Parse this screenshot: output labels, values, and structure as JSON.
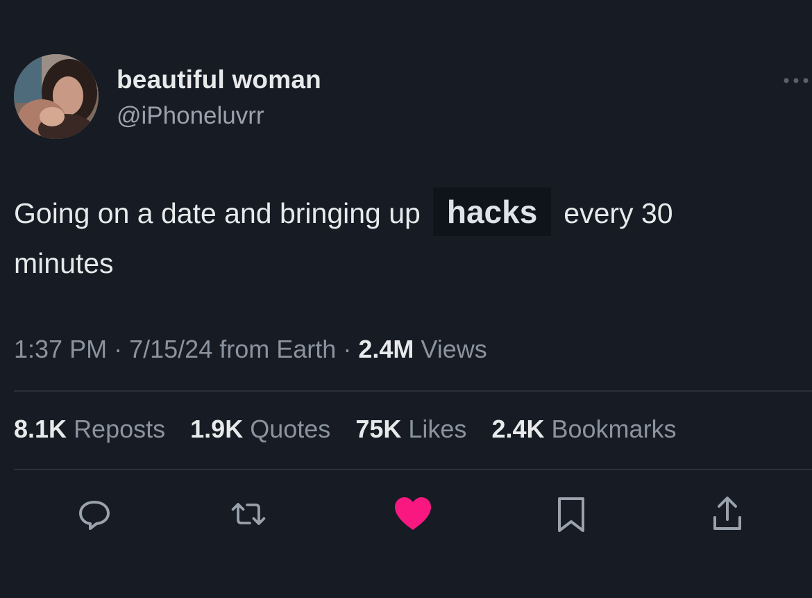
{
  "tweet": {
    "author_name": "beautiful woman",
    "author_handle": "@iPhoneluvrr",
    "text_before": "Going on a date and bringing up",
    "text_highlight": "hacks",
    "text_after": "every 30",
    "text_line2": "minutes"
  },
  "meta": {
    "time": "1:37 PM",
    "separator1": "·",
    "date": "7/15/24",
    "source": "from Earth",
    "separator2": "·",
    "views_count": "2.4M",
    "views_label": "Views"
  },
  "stats": {
    "reposts_count": "8.1K",
    "reposts_label": "Reposts",
    "quotes_count": "1.9K",
    "quotes_label": "Quotes",
    "likes_count": "75K",
    "likes_label": "Likes",
    "bookmarks_count": "2.4K",
    "bookmarks_label": "Bookmarks"
  },
  "icons": {
    "more": "more-icon",
    "reply": "reply-icon",
    "repost": "repost-icon",
    "like": "heart-icon",
    "bookmark": "bookmark-icon",
    "share": "share-icon"
  },
  "colors": {
    "background": "#161b24",
    "text_primary": "#e7e9ea",
    "text_secondary": "#8b949e",
    "like_active": "#f91880",
    "icon_default": "#9aa3ad"
  }
}
